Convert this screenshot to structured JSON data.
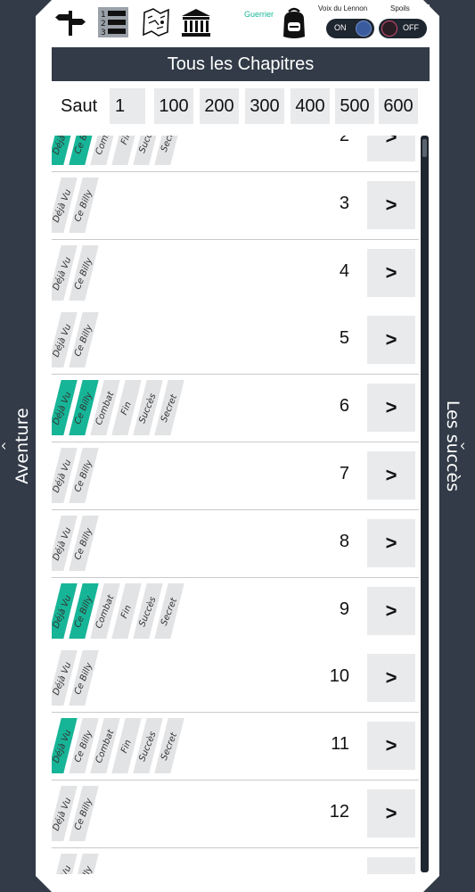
{
  "left_panel": {
    "label": "Aventure",
    "caret": "^"
  },
  "right_panel": {
    "label": "Les succès",
    "caret": "^"
  },
  "topbar": {
    "icons": [
      "signpost-icon",
      "numbered-list-icon",
      "map-icon",
      "museum-icon"
    ],
    "class_label": "Guerrier",
    "backpack_icon": "backpack-icon",
    "voice": {
      "label": "Voix du Lennon",
      "state": "ON"
    },
    "spoils": {
      "label": "Spoils",
      "state": "OFF"
    }
  },
  "title": "Tous les Chapitres",
  "jump": {
    "label": "Saut",
    "input_value": "1",
    "buttons": [
      "100",
      "200",
      "300",
      "400",
      "500",
      "600"
    ]
  },
  "tag_labels": [
    "Déjà Vu",
    "Ce Billy",
    "Combat",
    "Fin",
    "Succès",
    "Secret"
  ],
  "accent_color": "#17b597",
  "chapters": [
    {
      "number": "2",
      "tags": [
        true,
        true,
        false,
        false,
        false,
        false
      ],
      "count": 6
    },
    {
      "number": "3",
      "tags": [
        false,
        false
      ],
      "count": 2
    },
    {
      "number": "4",
      "tags": [
        false,
        false
      ],
      "count": 2
    },
    {
      "number": "5",
      "tags": [
        false,
        false
      ],
      "count": 2
    },
    {
      "number": "6",
      "tags": [
        true,
        true,
        false,
        false,
        false,
        false
      ],
      "count": 6
    },
    {
      "number": "7",
      "tags": [
        false,
        false
      ],
      "count": 2
    },
    {
      "number": "8",
      "tags": [
        false,
        false
      ],
      "count": 2
    },
    {
      "number": "9",
      "tags": [
        true,
        true,
        false,
        false,
        false,
        false
      ],
      "count": 6
    },
    {
      "number": "10",
      "tags": [
        false,
        false
      ],
      "count": 2
    },
    {
      "number": "11",
      "tags": [
        true,
        false,
        false,
        false,
        false,
        false
      ],
      "count": 6
    },
    {
      "number": "12",
      "tags": [
        false,
        false
      ],
      "count": 2
    },
    {
      "number": "",
      "tags": [
        false,
        false
      ],
      "count": 2
    }
  ],
  "go_label": ">"
}
